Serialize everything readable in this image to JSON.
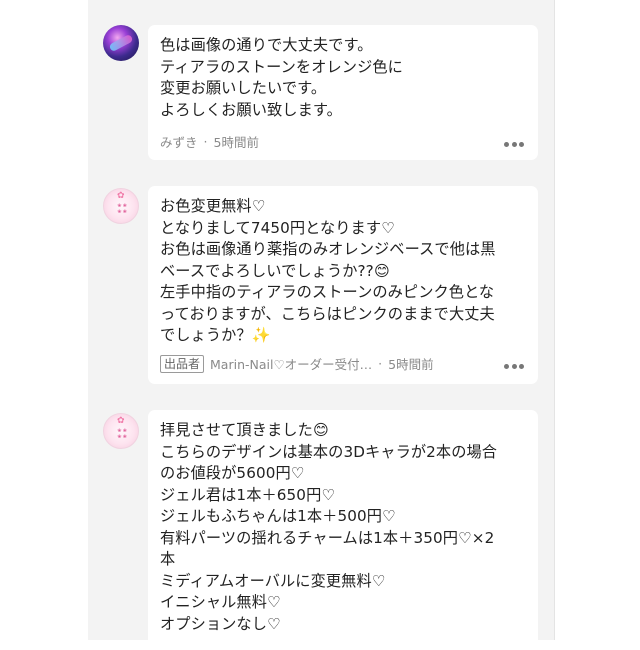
{
  "comments": [
    {
      "text": "色は画像の通りで大丈夫です。\nティアラのストーンをオレンジ色に\n変更お願いしたいです。\nよろしくお願い致します。",
      "author": "みずき",
      "separator": "·",
      "time": "5時間前"
    },
    {
      "text": "お色変更無料♡\nとなりまして7450円となります♡\nお色は画像通り薬指のみオレンジベースで他は黒\nベースでよろしいでしょうか??😊\n左手中指のティアラのストーンのみピンク色とな\nっておりますが、こちらはピンクのままで大丈夫\nでしょうか？✨",
      "seller_badge": "出品者",
      "author": "Marin-Nail♡オーダー受付…",
      "separator": "·",
      "time": "5時間前"
    },
    {
      "text": "拝見させて頂きました😊\nこちらのデザインは基本の3Dキャラが2本の場合\nのお値段が5600円♡\nジェル君は1本＋650円♡\nジェルもふちゃんは1本＋500円♡\n有料パーツの揺れるチャームは1本＋350円♡×2\n本\nミディアムオーバルに変更無料♡\nイニシャル無料♡\nオプションなし♡"
    }
  ],
  "icons": {
    "more": "more-dots-icon",
    "shop_logo_flower": "flower-icon"
  },
  "colors": {
    "panel_bg": "#f3f3f3",
    "bubble_bg": "#ffffff",
    "meta_text": "#8a8a8a"
  }
}
